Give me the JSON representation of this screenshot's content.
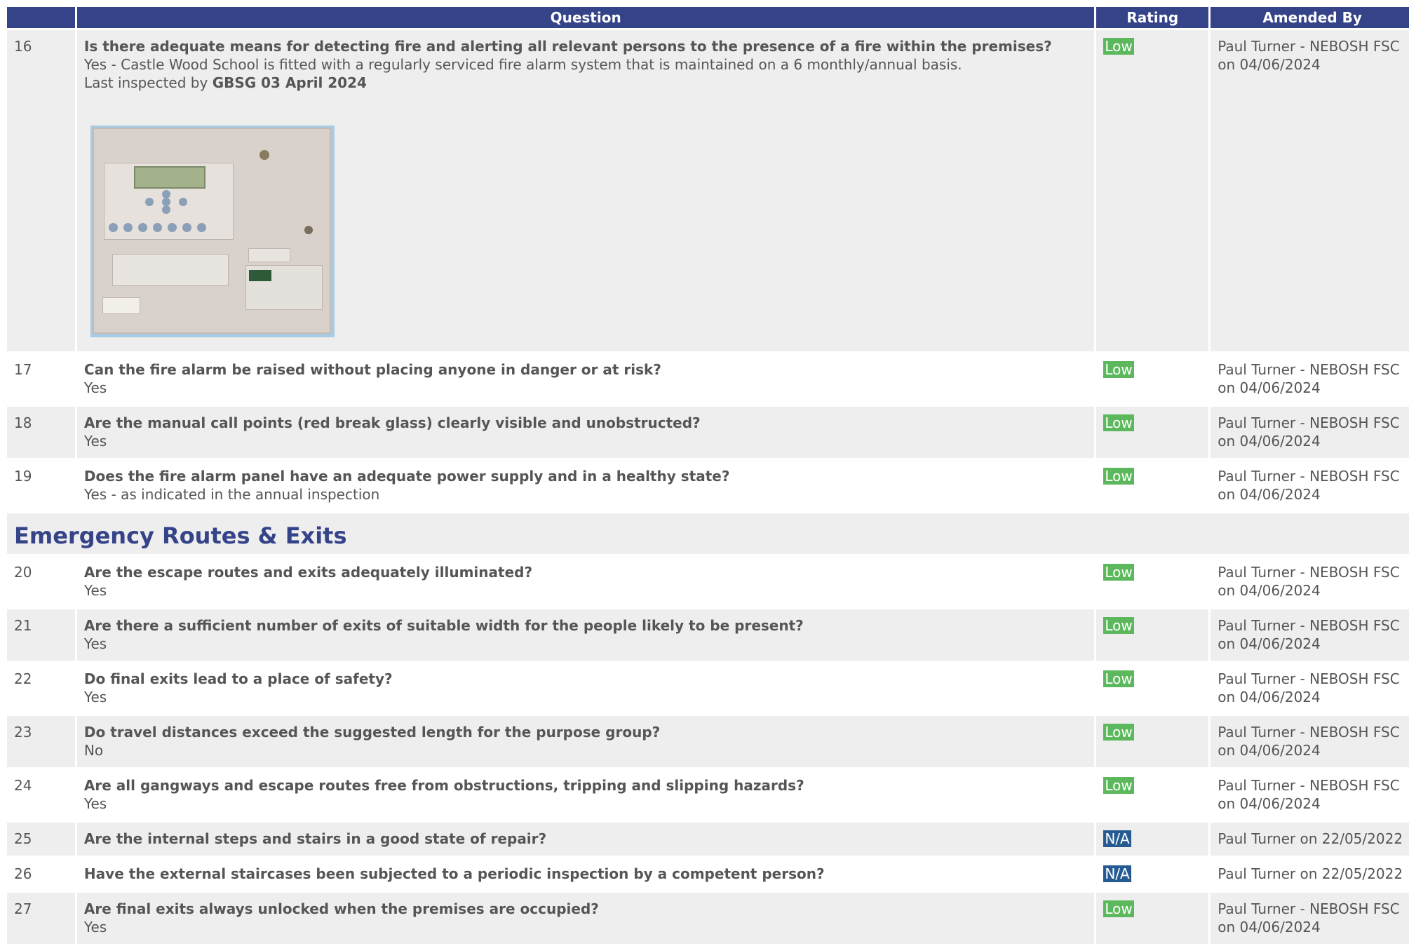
{
  "columns": {
    "question": "Question",
    "rating": "Rating",
    "amended_by": "Amended By"
  },
  "photo_alt": "Fire alarm panel",
  "rows_a": [
    {
      "num": "16",
      "question": "Is there adequate means for detecting fire and alerting all relevant persons to the presence of a fire within the premises?",
      "answer": "Yes - Castle Wood School is fitted with a regularly serviced fire alarm system that is maintained on a 6 monthly/annual basis.",
      "answer2_prefix": "Last inspected by ",
      "answer2_bold": "GBSG 03 April 2024",
      "rating": "Low",
      "amended_line1": "Paul Turner - NEBOSH FSC",
      "amended_line2": "on 04/06/2024"
    },
    {
      "num": "17",
      "question": "Can the fire alarm be raised without placing anyone in danger or at risk?",
      "answer": "Yes",
      "rating": "Low",
      "amended_line1": "Paul Turner - NEBOSH FSC",
      "amended_line2": "on 04/06/2024"
    },
    {
      "num": "18",
      "question": "Are the manual call points (red break glass) clearly visible and unobstructed?",
      "answer": "Yes",
      "rating": "Low",
      "amended_line1": "Paul Turner - NEBOSH FSC",
      "amended_line2": "on 04/06/2024"
    },
    {
      "num": "19",
      "question": "Does the fire alarm panel have an adequate power supply and in a healthy state?",
      "answer": "Yes - as indicated in the annual inspection",
      "rating": "Low",
      "amended_line1": "Paul Turner - NEBOSH FSC",
      "amended_line2": "on 04/06/2024"
    }
  ],
  "section_title": "Emergency Routes & Exits",
  "rows_b": [
    {
      "num": "20",
      "question": "Are the escape routes and exits adequately illuminated?",
      "answer": "Yes",
      "rating": "Low",
      "amended_line1": "Paul Turner - NEBOSH FSC",
      "amended_line2": "on 04/06/2024"
    },
    {
      "num": "21",
      "question": "Are there a sufficient number of exits of suitable width for the people likely to be present?",
      "answer": "Yes",
      "rating": "Low",
      "amended_line1": "Paul Turner - NEBOSH FSC",
      "amended_line2": "on 04/06/2024"
    },
    {
      "num": "22",
      "question": "Do final exits lead to a place of safety?",
      "answer": "Yes",
      "rating": "Low",
      "amended_line1": "Paul Turner - NEBOSH FSC",
      "amended_line2": "on 04/06/2024"
    },
    {
      "num": "23",
      "question": "Do travel distances exceed the suggested length for the purpose group?",
      "answer": "No",
      "rating": "Low",
      "amended_line1": "Paul Turner - NEBOSH FSC",
      "amended_line2": "on 04/06/2024"
    },
    {
      "num": "24",
      "question": "Are all gangways and escape routes free from obstructions, tripping and slipping hazards?",
      "answer": "Yes",
      "rating": "Low",
      "amended_line1": "Paul Turner - NEBOSH FSC",
      "amended_line2": "on 04/06/2024"
    },
    {
      "num": "25",
      "question": "Are the internal steps and stairs in a good state of repair?",
      "answer": "",
      "rating": "N/A",
      "amended_line1": "Paul Turner on 22/05/2022",
      "amended_line2": ""
    },
    {
      "num": "26",
      "question": "Have the external staircases been subjected to a periodic inspection by a competent person?",
      "answer": "",
      "rating": "N/A",
      "amended_line1": "Paul Turner on 22/05/2022",
      "amended_line2": ""
    },
    {
      "num": "27",
      "question": "Are final exits always unlocked when the premises are occupied?",
      "answer": "Yes",
      "rating": "Low",
      "amended_line1": "Paul Turner - NEBOSH FSC",
      "amended_line2": "on 04/06/2024"
    }
  ]
}
